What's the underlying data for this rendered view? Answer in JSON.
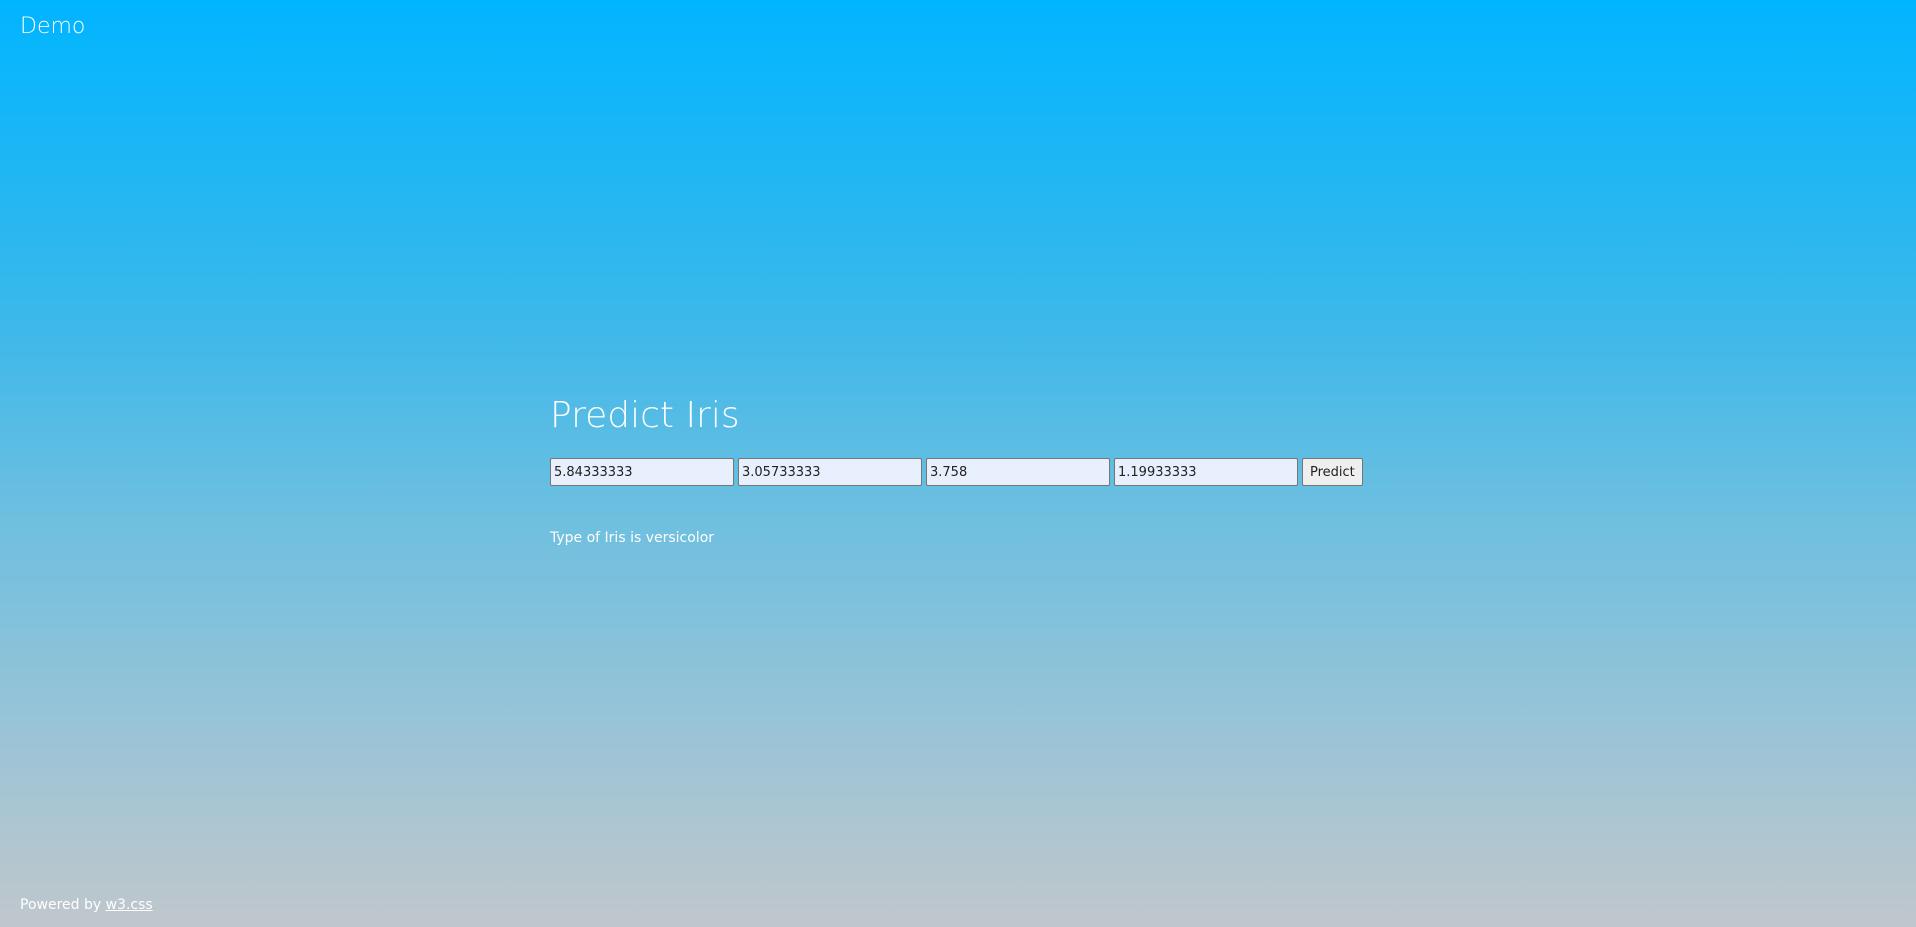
{
  "header": {
    "title": "Demo"
  },
  "main": {
    "title": "Predict Iris",
    "inputs": [
      {
        "value": "5.84333333"
      },
      {
        "value": "3.05733333"
      },
      {
        "value": "3.758"
      },
      {
        "value": "1.19933333"
      }
    ],
    "predict_label": "Predict",
    "result": "Type of Iris is versicolor"
  },
  "footer": {
    "prefix": "Powered by ",
    "link_text": "w3.css"
  }
}
